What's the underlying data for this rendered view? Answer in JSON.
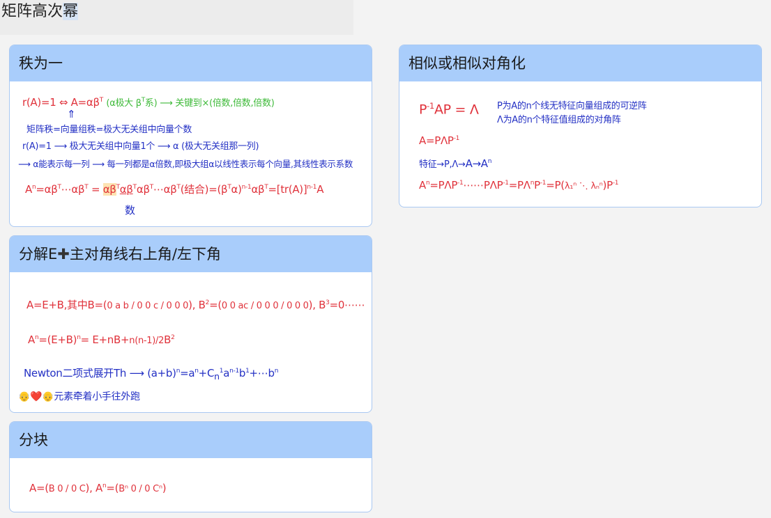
{
  "page": {
    "title_main": "矩阵高次",
    "title_highlight": "幂"
  },
  "rank_one": {
    "title": "秩为一",
    "l1_red": "r(A)=1 ⇔ A=αβ",
    "l1_sup": "T",
    "l1_green": "(α极大 β",
    "l1_green_sup": "T",
    "l1_green2": "系) ⟶ 关键到×(倍数,倍数,倍数)",
    "arrow_up": "⇑",
    "l2": "矩阵秩=向量组秩=极大无关组中向量个数",
    "l3": "r(A)=1 ⟶ 极大无关组中向量1个 ⟶ α (极大无关组那一列)",
    "l4": "⟶ α能表示每一列 ⟶ 每一列都是α倍数,即极大组α以线性表示每个向量,其线性表示系数",
    "l5_a": "A",
    "l5_a_sup": "n",
    "l5_b": "=αβ",
    "l5_b_sup": "T",
    "l5_c": "⋯αβ",
    "l5_c_sup": "T",
    "l5_d": "=",
    "l5_e": "αβ",
    "l5_e_sup": "T",
    "l5_f": "αβ",
    "l5_f_sup": "T",
    "l5_g": "αβ",
    "l5_g_sup": "T",
    "l5_h": "⋯αβ",
    "l5_h_sup": "T",
    "l5_i": "(结合)=(β",
    "l5_i_sup": "T",
    "l5_j": "α)",
    "l5_j_sup": "n-1",
    "l5_k": "αβ",
    "l5_k_sup": "T",
    "l5_l": "=[tr(A)]",
    "l5_l_sup": "n-1",
    "l5_m": "A",
    "l5_note": "数"
  },
  "similar": {
    "title": "相似或相似对角化",
    "l1": "P",
    "l1_sup": "-1",
    "l1b": "AP = Λ",
    "note1": "P为A的n个线无特征向量组成的可逆阵",
    "note2": "Λ为A的n个特征值组成的对角阵",
    "l2": "A=PΛP",
    "l2_sup": "-1",
    "l3_blue": "特征→P,Λ→",
    "l3_red": "A→A",
    "l3_sup": "n",
    "l4_a": "A",
    "l4_a_sup": "n",
    "l4_b": "=PΛP",
    "l4_b_sup": "-1",
    "l4_c": "⋯⋯PΛP",
    "l4_c_sup": "-1",
    "l4_d": "=PΛ",
    "l4_d_sup": "n",
    "l4_e": "P",
    "l4_e_sup": "-1",
    "l4_f": "=P(",
    "l4_lambda": "λ₁ⁿ ⋱ λₙⁿ",
    "l4_g": ")P",
    "l4_g_sup": "-1"
  },
  "decompose": {
    "title_a": "分解E",
    "title_b": "主对角线右上角/左下角",
    "l1_a": "A=E+B,其中B=(",
    "l1_m1": "0 a b / 0 0 c / 0 0 0",
    "l1_b": "), B",
    "l1_b_sup": "2",
    "l1_c": "=(",
    "l1_m2": "0 0 ac / 0 0 0 / 0 0 0",
    "l1_d": "), B",
    "l1_d_sup": "3",
    "l1_e": "=0⋯⋯",
    "l2_a": "A",
    "l2_a_sup": "n",
    "l2_b": "=(E+B)",
    "l2_b_sup": "n",
    "l2_c": "= E+nB+",
    "l2_frac": "n(n-1)/2",
    "l2_d": "B",
    "l2_d_sup": "2",
    "l3": "Newton二项式展开Th ⟶ (a+b)",
    "l3_sup": "n",
    "l3b": "=a",
    "l3b_sup": "n",
    "l3c": "+C",
    "l3c_sub": "n",
    "l3c_sup": "1",
    "l3d": "a",
    "l3d_sup": "n-1",
    "l3e": "b",
    "l3e_sup": "1",
    "l3f": "+⋯b",
    "l3f_sup": "n",
    "emoji": "👴❤️👴",
    "caption": "元素牵着小手往外跑"
  },
  "block": {
    "title": "分块",
    "l1_a": "A=(",
    "l1_m": "B 0 / 0 C",
    "l1_b": "),  A",
    "l1_b_sup": "n",
    "l1_c": "=(",
    "l1_m2": "Bⁿ 0 / 0 Cⁿ",
    "l1_d": ")"
  }
}
